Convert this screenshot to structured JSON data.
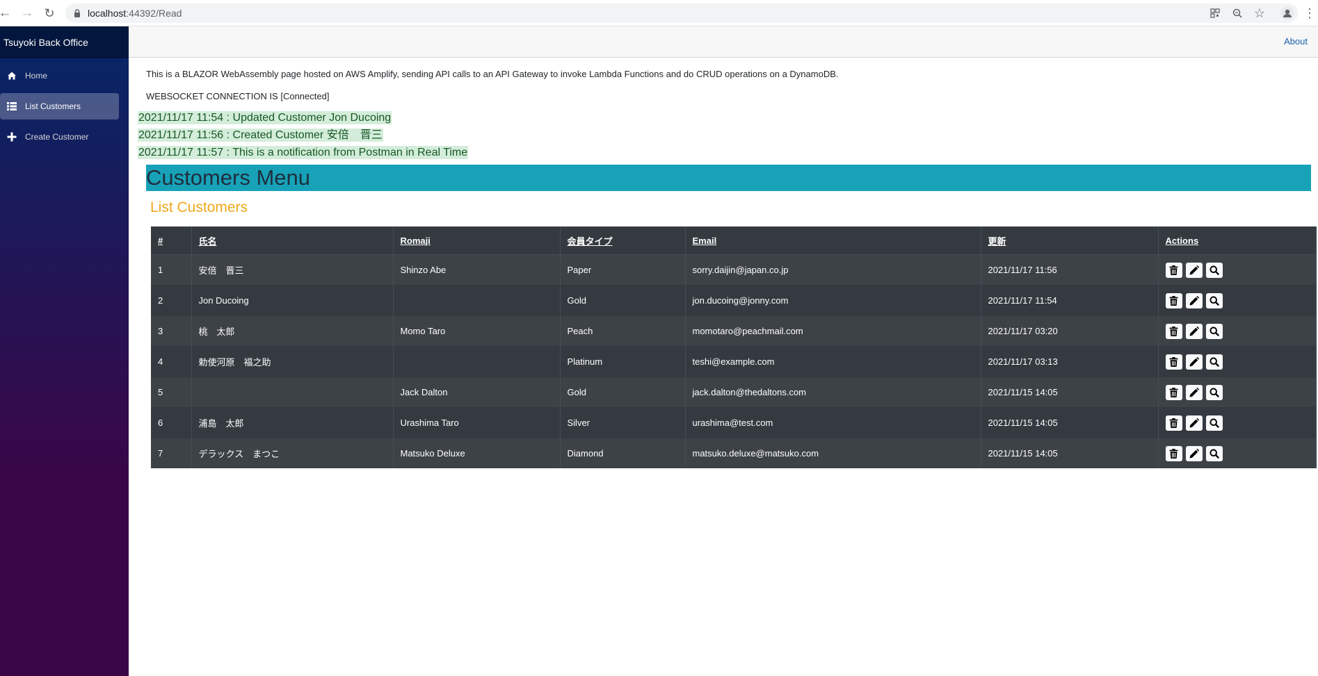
{
  "browser": {
    "url_host": "localhost",
    "url_path": ":44392/Read"
  },
  "sidebar": {
    "brand": "Tsuyoki Back Office",
    "items": [
      {
        "label": "Home",
        "icon": "home-icon"
      },
      {
        "label": "List Customers",
        "icon": "list-icon",
        "active": true
      },
      {
        "label": "Create Customer",
        "icon": "plus-icon"
      }
    ]
  },
  "topbar": {
    "about": "About"
  },
  "intro": "This is a BLAZOR WebAssembly page hosted on AWS Amplify, sending API calls to an API Gateway to invoke Lambda Functions and do CRUD operations on a DynamoDB.",
  "websocket_status": "WEBSOCKET CONNECTION IS [Connected]",
  "notifications": [
    "2021/11/17 11:54 : Updated Customer Jon Ducoing",
    "2021/11/17 11:56 : Created Customer 安倍　晋三",
    "2021/11/17 11:57 : This is a notification from Postman in Real Time"
  ],
  "menu_title": "Customers Menu",
  "subtitle": "List Customers",
  "table": {
    "headers": [
      "#",
      "氏名",
      "Romaji",
      "会員タイプ",
      "Email",
      "更新",
      "Actions"
    ],
    "rows": [
      [
        "1",
        "安倍　晋三",
        "Shinzo Abe",
        "Paper",
        "sorry.daijin@japan.co.jp",
        "2021/11/17 11:56"
      ],
      [
        "2",
        "Jon Ducoing",
        "",
        "Gold",
        "jon.ducoing@jonny.com",
        "2021/11/17 11:54"
      ],
      [
        "3",
        "桃　太郎",
        "Momo Taro",
        "Peach",
        "momotaro@peachmail.com",
        "2021/11/17 03:20"
      ],
      [
        "4",
        "勅使河原　福之助",
        "",
        "Platinum",
        "teshi@example.com",
        "2021/11/17 03:13"
      ],
      [
        "5",
        "",
        "Jack Dalton",
        "Gold",
        "jack.dalton@thedaltons.com",
        "2021/11/15 14:05"
      ],
      [
        "6",
        "浦島　太郎",
        "Urashima Taro",
        "Silver",
        "urashima@test.com",
        "2021/11/15 14:05"
      ],
      [
        "7",
        "デラックス　まつこ",
        "Matsuko Deluxe",
        "Diamond",
        "matsuko.deluxe@matsuko.com",
        "2021/11/15 14:05"
      ]
    ],
    "actions": [
      "trash-icon",
      "pencil-icon",
      "search-icon"
    ]
  },
  "colors": {
    "sidebar_top": "#052767",
    "sidebar_bottom": "#3a0647",
    "banner": "#17a2b8",
    "subtitle": "#f0a81e",
    "notice_bg": "#d4edda",
    "table_bg": "#343a40"
  }
}
